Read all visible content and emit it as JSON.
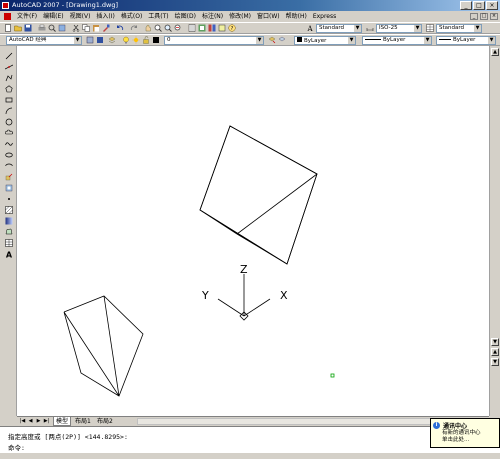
{
  "window": {
    "title": "AutoCAD 2007 - [Drawing1.dwg]",
    "controls": [
      "_",
      "□",
      "×"
    ]
  },
  "menubar": {
    "items": [
      "文件(F)",
      "编辑(E)",
      "视图(V)",
      "插入(I)",
      "格式(O)",
      "工具(T)",
      "绘图(D)",
      "标注(N)",
      "修改(M)",
      "窗口(W)",
      "帮助(H)",
      "Express"
    ],
    "doc_controls": [
      "_",
      "□",
      "×"
    ]
  },
  "toolbar_styles": {
    "text_style": "Standard",
    "dim_style": "ISO-25",
    "table_style": "Standard"
  },
  "toolbar_properties": {
    "workspace": "AutoCAD 经典",
    "layer": "0",
    "color": "ByLayer",
    "linetype": "ByLayer",
    "lineweight": "ByLayer"
  },
  "canvas": {
    "ucs": {
      "z": "Z",
      "y": "Y",
      "x": "X"
    }
  },
  "tabs": {
    "model": "模型",
    "layout1": "布局1",
    "layout2": "布局2"
  },
  "command": {
    "line1": "指定高度或 [两点(2P)] <144.8295>:",
    "line2": "命令:"
  },
  "balloon": {
    "title": "通讯中心",
    "text_line1": "有新的通讯中心",
    "text_line2": "单击此处..."
  },
  "colors": {
    "canvas_bg": "#ffffff",
    "chrome": "#d4d0c8",
    "titlebar": "#0a246a",
    "balloon_bg": "#ffffe1",
    "osnap_marker": "#00a000"
  }
}
